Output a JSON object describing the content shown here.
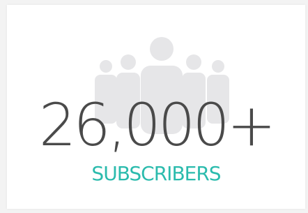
{
  "card": {
    "value": "26,000+",
    "label": "SUBSCRIBERS",
    "icon": "people-group-icon",
    "colors": {
      "value": "#4a4a4a",
      "label": "#2bbbad",
      "icon": "#e6e6e8",
      "background": "#ffffff"
    }
  }
}
